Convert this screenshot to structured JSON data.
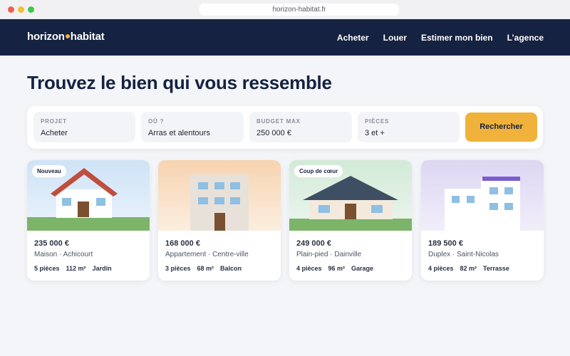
{
  "browser": {
    "url": "horizon-habitat.fr"
  },
  "brand": {
    "name_left": "horizon",
    "name_right": "habitat",
    "accent_color": "#f0b23a",
    "nav_bg": "#152241"
  },
  "nav": {
    "items": [
      "Acheter",
      "Louer",
      "Estimer mon bien",
      "L’agence"
    ]
  },
  "hero": {
    "title": "Trouvez le bien qui vous ressemble"
  },
  "search": {
    "fields": [
      {
        "label": "Projet",
        "value": "Acheter"
      },
      {
        "label": "Où ?",
        "value": "Arras et alentours"
      },
      {
        "label": "Budget max",
        "value": "250 000 €"
      },
      {
        "label": "Pièces",
        "value": "3 et +"
      }
    ],
    "button_label": "Rechercher"
  },
  "listings": [
    {
      "badge": "Nouveau",
      "price": "235 000 €",
      "location": "Maison · Achicourt",
      "features": [
        "5 pièces",
        "112 m²",
        "Jardin"
      ]
    },
    {
      "badge": "",
      "price": "168 000 €",
      "location": "Appartement · Centre-ville",
      "features": [
        "3 pièces",
        "68 m²",
        "Balcon"
      ]
    },
    {
      "badge": "Coup de cœur",
      "price": "249 000 €",
      "location": "Plain-pied · Dainville",
      "features": [
        "4 pièces",
        "96 m²",
        "Garage"
      ]
    },
    {
      "badge": "",
      "price": "189 500 €",
      "location": "Duplex · Saint-Nicolas",
      "features": [
        "4 pièces",
        "82 m²",
        "Terrasse"
      ]
    }
  ]
}
